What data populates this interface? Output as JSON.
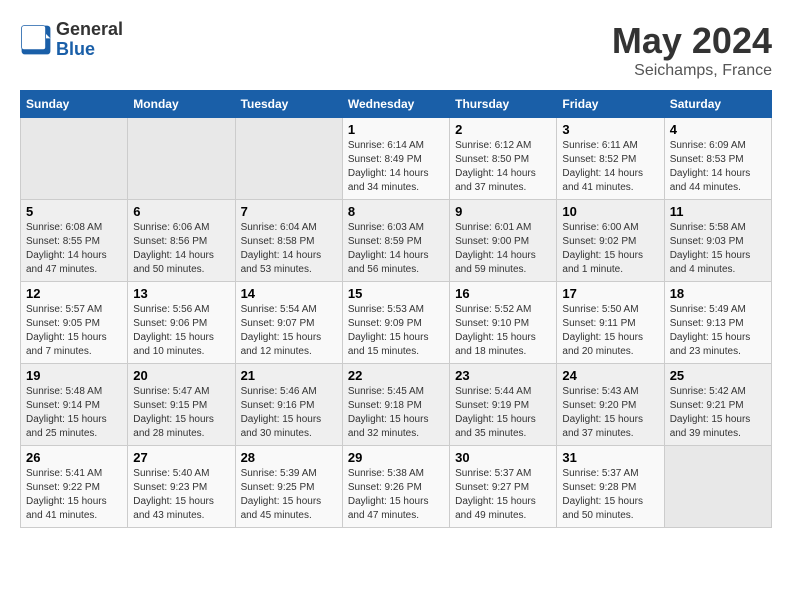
{
  "logo": {
    "general": "General",
    "blue": "Blue"
  },
  "title": "May 2024",
  "subtitle": "Seichamps, France",
  "days_header": [
    "Sunday",
    "Monday",
    "Tuesday",
    "Wednesday",
    "Thursday",
    "Friday",
    "Saturday"
  ],
  "weeks": [
    [
      {
        "day": "",
        "info": ""
      },
      {
        "day": "",
        "info": ""
      },
      {
        "day": "",
        "info": ""
      },
      {
        "day": "1",
        "info": "Sunrise: 6:14 AM\nSunset: 8:49 PM\nDaylight: 14 hours\nand 34 minutes."
      },
      {
        "day": "2",
        "info": "Sunrise: 6:12 AM\nSunset: 8:50 PM\nDaylight: 14 hours\nand 37 minutes."
      },
      {
        "day": "3",
        "info": "Sunrise: 6:11 AM\nSunset: 8:52 PM\nDaylight: 14 hours\nand 41 minutes."
      },
      {
        "day": "4",
        "info": "Sunrise: 6:09 AM\nSunset: 8:53 PM\nDaylight: 14 hours\nand 44 minutes."
      }
    ],
    [
      {
        "day": "5",
        "info": "Sunrise: 6:08 AM\nSunset: 8:55 PM\nDaylight: 14 hours\nand 47 minutes."
      },
      {
        "day": "6",
        "info": "Sunrise: 6:06 AM\nSunset: 8:56 PM\nDaylight: 14 hours\nand 50 minutes."
      },
      {
        "day": "7",
        "info": "Sunrise: 6:04 AM\nSunset: 8:58 PM\nDaylight: 14 hours\nand 53 minutes."
      },
      {
        "day": "8",
        "info": "Sunrise: 6:03 AM\nSunset: 8:59 PM\nDaylight: 14 hours\nand 56 minutes."
      },
      {
        "day": "9",
        "info": "Sunrise: 6:01 AM\nSunset: 9:00 PM\nDaylight: 14 hours\nand 59 minutes."
      },
      {
        "day": "10",
        "info": "Sunrise: 6:00 AM\nSunset: 9:02 PM\nDaylight: 15 hours\nand 1 minute."
      },
      {
        "day": "11",
        "info": "Sunrise: 5:58 AM\nSunset: 9:03 PM\nDaylight: 15 hours\nand 4 minutes."
      }
    ],
    [
      {
        "day": "12",
        "info": "Sunrise: 5:57 AM\nSunset: 9:05 PM\nDaylight: 15 hours\nand 7 minutes."
      },
      {
        "day": "13",
        "info": "Sunrise: 5:56 AM\nSunset: 9:06 PM\nDaylight: 15 hours\nand 10 minutes."
      },
      {
        "day": "14",
        "info": "Sunrise: 5:54 AM\nSunset: 9:07 PM\nDaylight: 15 hours\nand 12 minutes."
      },
      {
        "day": "15",
        "info": "Sunrise: 5:53 AM\nSunset: 9:09 PM\nDaylight: 15 hours\nand 15 minutes."
      },
      {
        "day": "16",
        "info": "Sunrise: 5:52 AM\nSunset: 9:10 PM\nDaylight: 15 hours\nand 18 minutes."
      },
      {
        "day": "17",
        "info": "Sunrise: 5:50 AM\nSunset: 9:11 PM\nDaylight: 15 hours\nand 20 minutes."
      },
      {
        "day": "18",
        "info": "Sunrise: 5:49 AM\nSunset: 9:13 PM\nDaylight: 15 hours\nand 23 minutes."
      }
    ],
    [
      {
        "day": "19",
        "info": "Sunrise: 5:48 AM\nSunset: 9:14 PM\nDaylight: 15 hours\nand 25 minutes."
      },
      {
        "day": "20",
        "info": "Sunrise: 5:47 AM\nSunset: 9:15 PM\nDaylight: 15 hours\nand 28 minutes."
      },
      {
        "day": "21",
        "info": "Sunrise: 5:46 AM\nSunset: 9:16 PM\nDaylight: 15 hours\nand 30 minutes."
      },
      {
        "day": "22",
        "info": "Sunrise: 5:45 AM\nSunset: 9:18 PM\nDaylight: 15 hours\nand 32 minutes."
      },
      {
        "day": "23",
        "info": "Sunrise: 5:44 AM\nSunset: 9:19 PM\nDaylight: 15 hours\nand 35 minutes."
      },
      {
        "day": "24",
        "info": "Sunrise: 5:43 AM\nSunset: 9:20 PM\nDaylight: 15 hours\nand 37 minutes."
      },
      {
        "day": "25",
        "info": "Sunrise: 5:42 AM\nSunset: 9:21 PM\nDaylight: 15 hours\nand 39 minutes."
      }
    ],
    [
      {
        "day": "26",
        "info": "Sunrise: 5:41 AM\nSunset: 9:22 PM\nDaylight: 15 hours\nand 41 minutes."
      },
      {
        "day": "27",
        "info": "Sunrise: 5:40 AM\nSunset: 9:23 PM\nDaylight: 15 hours\nand 43 minutes."
      },
      {
        "day": "28",
        "info": "Sunrise: 5:39 AM\nSunset: 9:25 PM\nDaylight: 15 hours\nand 45 minutes."
      },
      {
        "day": "29",
        "info": "Sunrise: 5:38 AM\nSunset: 9:26 PM\nDaylight: 15 hours\nand 47 minutes."
      },
      {
        "day": "30",
        "info": "Sunrise: 5:37 AM\nSunset: 9:27 PM\nDaylight: 15 hours\nand 49 minutes."
      },
      {
        "day": "31",
        "info": "Sunrise: 5:37 AM\nSunset: 9:28 PM\nDaylight: 15 hours\nand 50 minutes."
      },
      {
        "day": "",
        "info": ""
      }
    ]
  ]
}
